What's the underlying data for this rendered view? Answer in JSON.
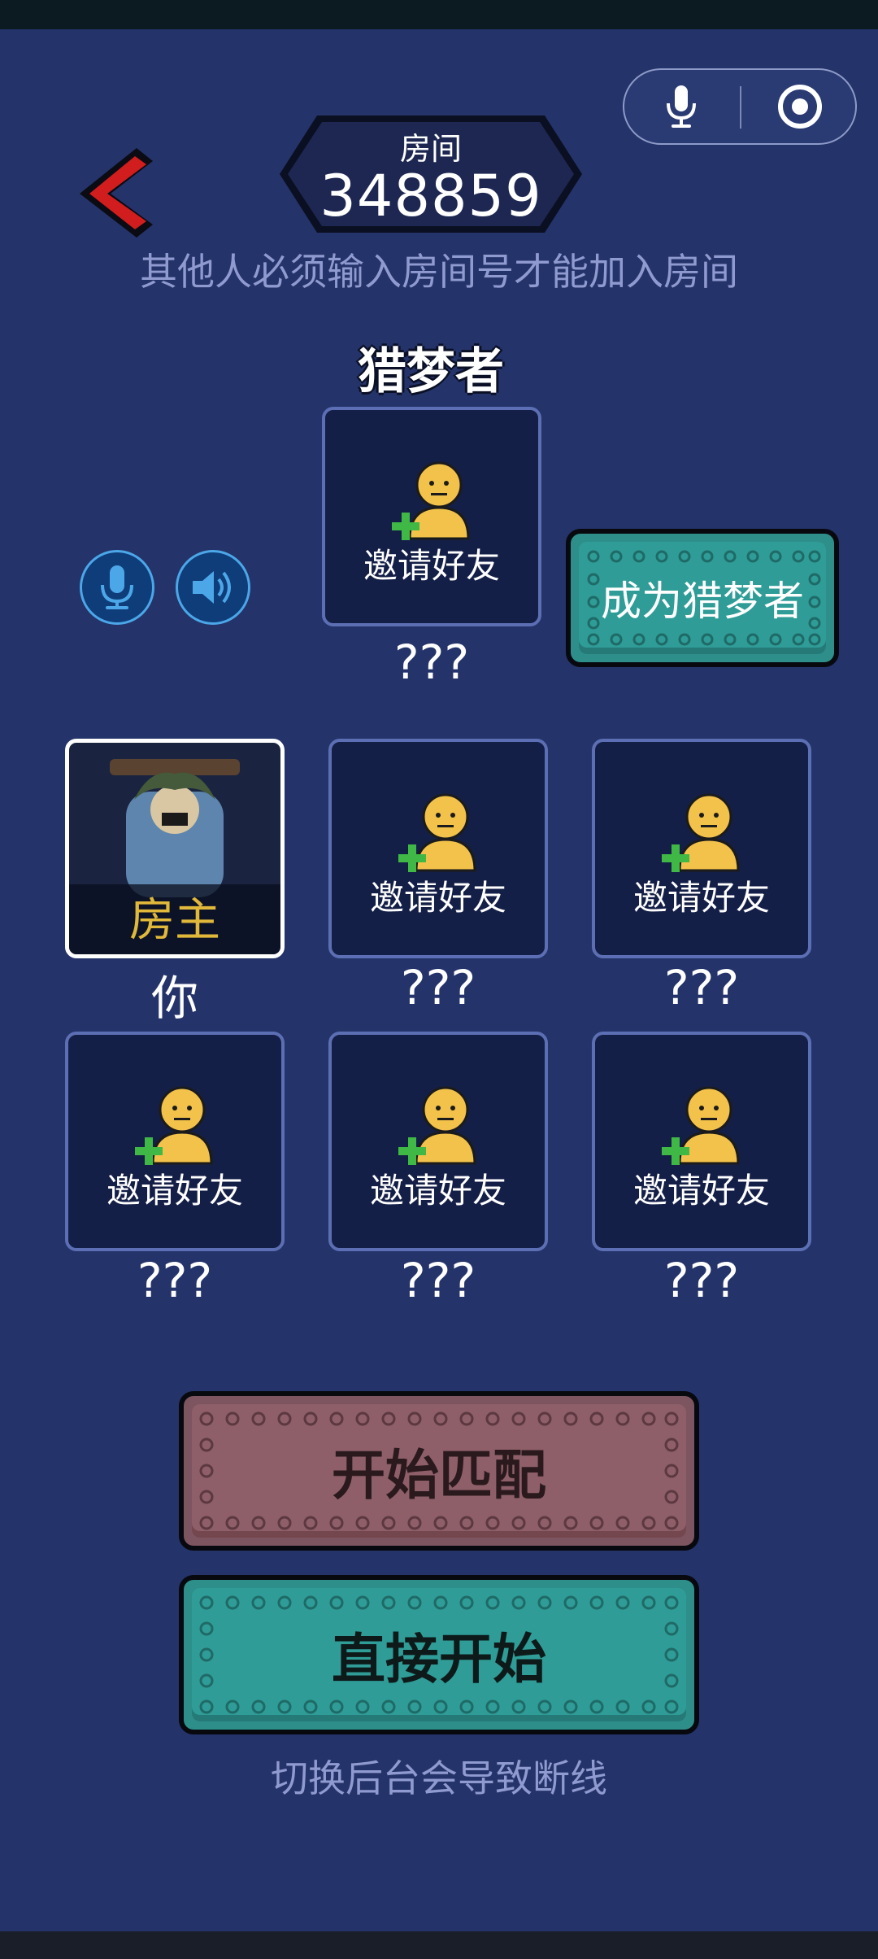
{
  "room": {
    "label": "房间",
    "number": "348859",
    "hint": "其他人必须输入房间号才能加入房间"
  },
  "dreamcatcher": {
    "title": "猎梦者",
    "slot_invite": "邀请好友",
    "slot_name": "???",
    "become_button": "成为猎梦者"
  },
  "players": [
    {
      "host_badge": "房主",
      "name": "你"
    },
    {
      "invite": "邀请好友",
      "name": "???"
    },
    {
      "invite": "邀请好友",
      "name": "???"
    },
    {
      "invite": "邀请好友",
      "name": "???"
    },
    {
      "invite": "邀请好友",
      "name": "???"
    },
    {
      "invite": "邀请好友",
      "name": "???"
    }
  ],
  "buttons": {
    "match": "开始匹配",
    "start": "直接开始"
  },
  "footer_hint": "切换后台会导致断线",
  "icons": {
    "capsule_left": "microphone-icon",
    "capsule_right": "record-target-icon",
    "back": "back-arrow-icon",
    "voice_mic": "microphone-icon",
    "voice_speaker": "speaker-icon",
    "invite": "add-person-icon"
  },
  "colors": {
    "background": "#243369",
    "accent_green": "#2f9c97",
    "accent_red": "#8e5f68",
    "hint_text": "#8f9ad0",
    "host_gold": "#e0b83a",
    "back_arrow": "#d11d1d"
  }
}
